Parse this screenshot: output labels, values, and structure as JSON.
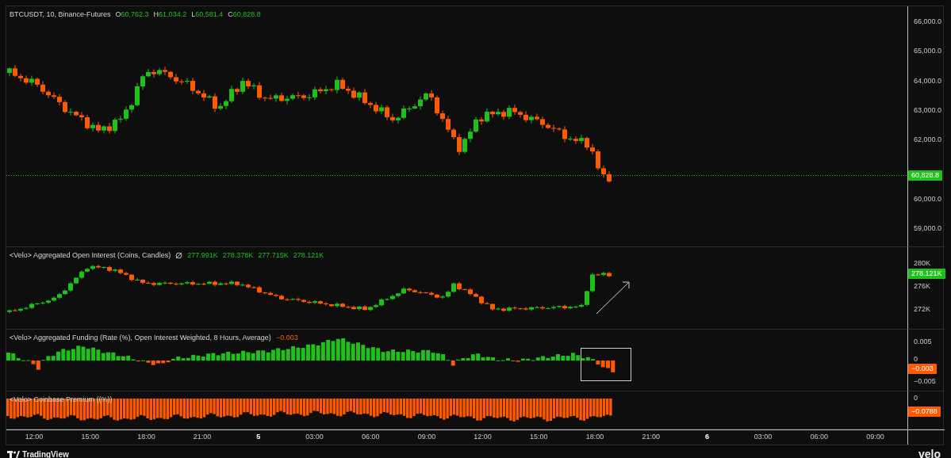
{
  "legend": {
    "symbol": "BTCUSDT, 10, Binance-Futures",
    "ohlc": [
      {
        "label": "O",
        "value": "60,762.3"
      },
      {
        "label": "H",
        "value": "61,034.2"
      },
      {
        "label": "L",
        "value": "60,581.4"
      },
      {
        "label": "C",
        "value": "60,828.8"
      }
    ]
  },
  "panes": [
    {
      "kind": "price",
      "axis_labels": [
        "66,000.0",
        "65,000.0",
        "64,000.0",
        "63,000.0",
        "62,000.0",
        "60,000.0",
        "59,000.0"
      ],
      "last_value": {
        "text": "60,828.8",
        "color": "#1fc01a"
      }
    },
    {
      "kind": "open_interest",
      "title": "<Velo> Aggregated Open Interest (Coins, Candles)",
      "values": [
        "277.991K",
        "278.378K",
        "277.715K",
        "278.121K"
      ],
      "axis_labels": [
        "280K",
        "276K",
        "272K"
      ],
      "last_value": {
        "text": "278.121K",
        "color": "#1fc01a"
      }
    },
    {
      "kind": "funding",
      "title": "<Velo> Aggregated Funding (Rate (%), Open Interest Weighted, 8 Hours, Average)",
      "values": [
        "−0.003"
      ],
      "axis_labels": [
        "0.005",
        "0",
        "−0.005"
      ],
      "last_value": {
        "text": "−0.003",
        "color": "#ff5a00"
      }
    },
    {
      "kind": "premium",
      "title": "<Velo> Coinbase Premium ((%))",
      "axis_labels": [
        "0"
      ],
      "last_value": {
        "text": "−0.0788",
        "color": "#ff5a00"
      }
    }
  ],
  "time_axis": [
    {
      "label": "12:00",
      "kind": "time"
    },
    {
      "label": "15:00",
      "kind": "time"
    },
    {
      "label": "18:00",
      "kind": "time"
    },
    {
      "label": "21:00",
      "kind": "time"
    },
    {
      "label": "5",
      "kind": "day"
    },
    {
      "label": "03:00",
      "kind": "time"
    },
    {
      "label": "06:00",
      "kind": "time"
    },
    {
      "label": "09:00",
      "kind": "time"
    },
    {
      "label": "12:00",
      "kind": "time"
    },
    {
      "label": "15:00",
      "kind": "time"
    },
    {
      "label": "18:00",
      "kind": "time"
    },
    {
      "label": "21:00",
      "kind": "time"
    },
    {
      "label": "6",
      "kind": "day"
    },
    {
      "label": "03:00",
      "kind": "time"
    },
    {
      "label": "06:00",
      "kind": "time"
    },
    {
      "label": "09:00",
      "kind": "time"
    }
  ],
  "footer": {
    "brand": "TradingView",
    "mark": "velo"
  }
}
